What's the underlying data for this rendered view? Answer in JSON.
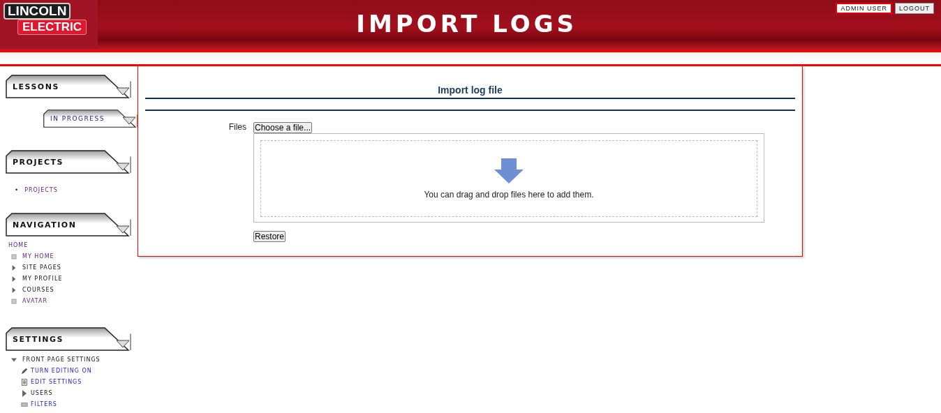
{
  "header": {
    "logo": {
      "line1": "LINCOLN",
      "line2": "ELECTRIC"
    },
    "title": "IMPORT LOGS",
    "user": "ADMIN USER",
    "logout": "LOGOUT"
  },
  "sidebar": [
    {
      "title": "LESSONS",
      "kind": "block",
      "sub": {
        "title": "IN PROGRESS"
      }
    },
    {
      "title": "PROJECTS",
      "kind": "block",
      "items": [
        {
          "label": "PROJECTS",
          "bullet": "•"
        }
      ]
    },
    {
      "title": "NAVIGATION",
      "kind": "nav",
      "home": "HOME",
      "items": [
        {
          "label": "MY HOME",
          "kind": "leaf"
        },
        {
          "label": "SITE PAGES",
          "kind": "branch"
        },
        {
          "label": "MY PROFILE",
          "kind": "branch"
        },
        {
          "label": "COURSES",
          "kind": "branch"
        },
        {
          "label": "AVATAR",
          "kind": "leaf"
        }
      ]
    },
    {
      "title": "SETTINGS",
      "kind": "settings",
      "node": {
        "label": "FRONT PAGE SETTINGS",
        "expanded": true,
        "children": [
          {
            "label": "TURN EDITING ON",
            "kind": "pencil"
          },
          {
            "label": "EDIT SETTINGS",
            "kind": "document"
          },
          {
            "label": "USERS",
            "kind": "branch"
          },
          {
            "label": "FILTERS",
            "kind": "filter"
          }
        ]
      }
    }
  ],
  "main": {
    "heading": "Import log file",
    "field_label": "Files",
    "choose_button": "Choose a file...",
    "drop_text": "You can drag and drop files here to add them.",
    "restore_button": "Restore"
  }
}
